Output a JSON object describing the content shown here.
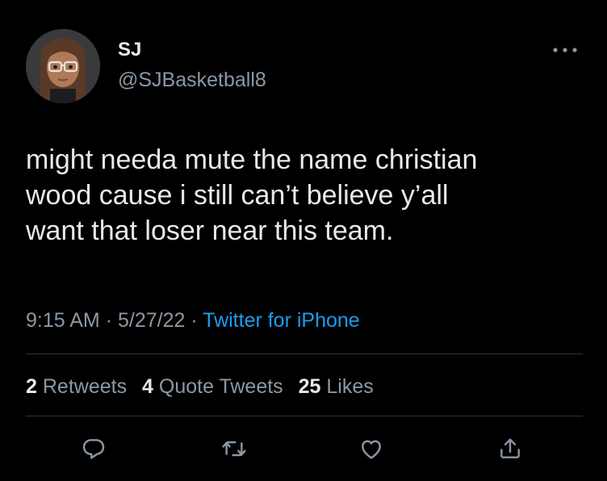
{
  "user": {
    "display_name": "SJ",
    "handle": "@SJBasketball8",
    "avatar_icon": "memoji-avatar"
  },
  "tweet": {
    "text": "might needa mute the name christian\nwood cause i still can’t believe y’all\nwant that loser near this team.",
    "time": "9:15 AM",
    "separator": "·",
    "date": "5/27/22",
    "source": "Twitter for iPhone"
  },
  "stats": {
    "retweets_count": "2",
    "retweets_label": "Retweets",
    "quotes_count": "4",
    "quotes_label": "Quote Tweets",
    "likes_count": "25",
    "likes_label": "Likes"
  },
  "actions": [
    "reply-icon",
    "retweet-icon",
    "like-icon",
    "share-icon"
  ],
  "colors": {
    "background": "#000000",
    "primary_text": "#e7e9ea",
    "secondary_text": "#8b98a5",
    "link": "#1d9bf0",
    "divider": "#2f3336"
  }
}
